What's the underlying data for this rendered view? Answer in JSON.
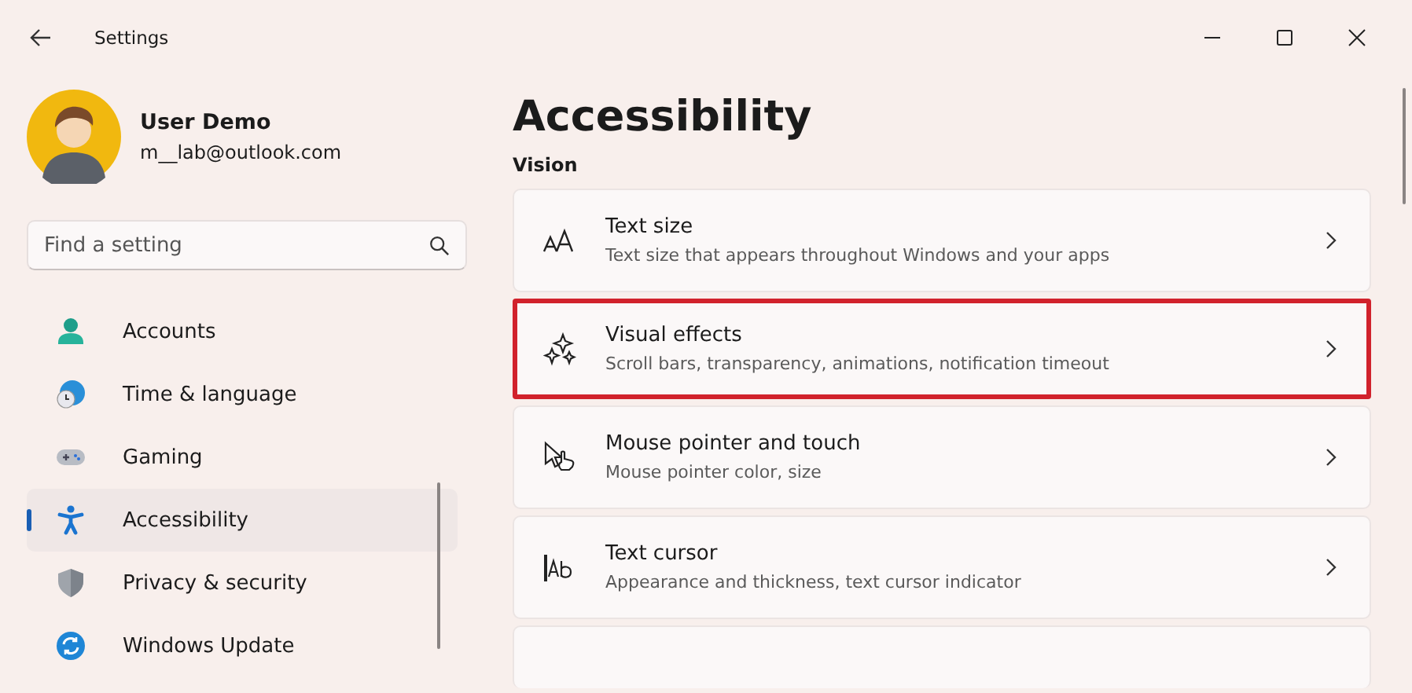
{
  "window": {
    "title": "Settings"
  },
  "account": {
    "name": "User Demo",
    "email": "m__lab@outlook.com"
  },
  "search": {
    "placeholder": "Find a setting"
  },
  "sidebar": {
    "items": [
      {
        "label": "Accounts",
        "kind": "accounts",
        "selected": false
      },
      {
        "label": "Time & language",
        "kind": "time",
        "selected": false
      },
      {
        "label": "Gaming",
        "kind": "gaming",
        "selected": false
      },
      {
        "label": "Accessibility",
        "kind": "accessibility",
        "selected": true
      },
      {
        "label": "Privacy & security",
        "kind": "privacy",
        "selected": false
      },
      {
        "label": "Windows Update",
        "kind": "update",
        "selected": false
      }
    ]
  },
  "page": {
    "title": "Accessibility",
    "section": "Vision",
    "cards": [
      {
        "title": "Text size",
        "description": "Text size that appears throughout Windows and your apps",
        "kind": "textsize",
        "highlighted": false
      },
      {
        "title": "Visual effects",
        "description": "Scroll bars, transparency, animations, notification timeout",
        "kind": "effects",
        "highlighted": true
      },
      {
        "title": "Mouse pointer and touch",
        "description": "Mouse pointer color, size",
        "kind": "pointer",
        "highlighted": false
      },
      {
        "title": "Text cursor",
        "description": "Appearance and thickness, text cursor indicator",
        "kind": "cursor",
        "highlighted": false
      }
    ]
  }
}
